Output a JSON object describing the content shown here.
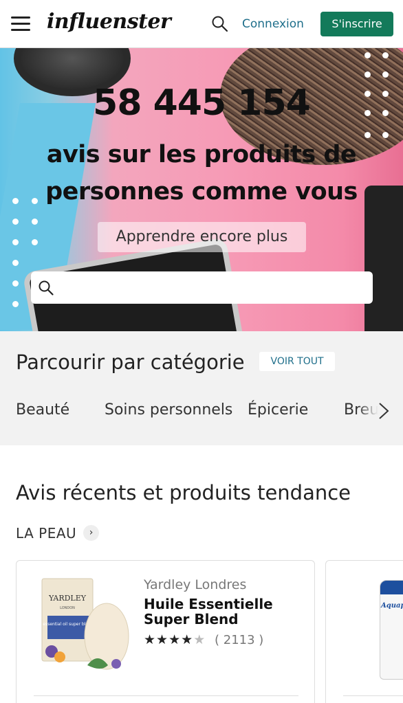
{
  "header": {
    "logo": "influenster",
    "login_label": "Connexion",
    "signup_label": "S'inscrire",
    "menu_icon": "hamburger-menu-icon",
    "search_icon": "search-icon"
  },
  "hero": {
    "count": "58 445 154",
    "subtitle": "avis sur les produits de personnes comme vous",
    "learn_more": "Apprendre encore plus",
    "search_placeholder": ""
  },
  "categories": {
    "title": "Parcourir par catégorie",
    "see_all": "VOIR TOUT",
    "items": [
      "Beauté",
      "Soins personnels",
      "Épicerie",
      "Breu"
    ]
  },
  "recent": {
    "title": "Avis récents et produits tendance",
    "subcategory": "LA PEAU",
    "products": [
      {
        "brand": "Yardley Londres",
        "name": "Huile Essentielle Super Blend",
        "rating": 4.5,
        "review_count": "( 2113 )",
        "image_text_brand": "YARDLEY",
        "image_text_sub": "LONDON",
        "image_label": "essential oil super blend"
      },
      {
        "brand": "Aquaphor",
        "image_text_brand": "Aquaphor"
      }
    ]
  },
  "colors": {
    "brand_green": "#137a5a",
    "link_blue": "#1e6e8a",
    "hero_pink": "#f69bb6",
    "hero_blue": "#62c3e6"
  }
}
